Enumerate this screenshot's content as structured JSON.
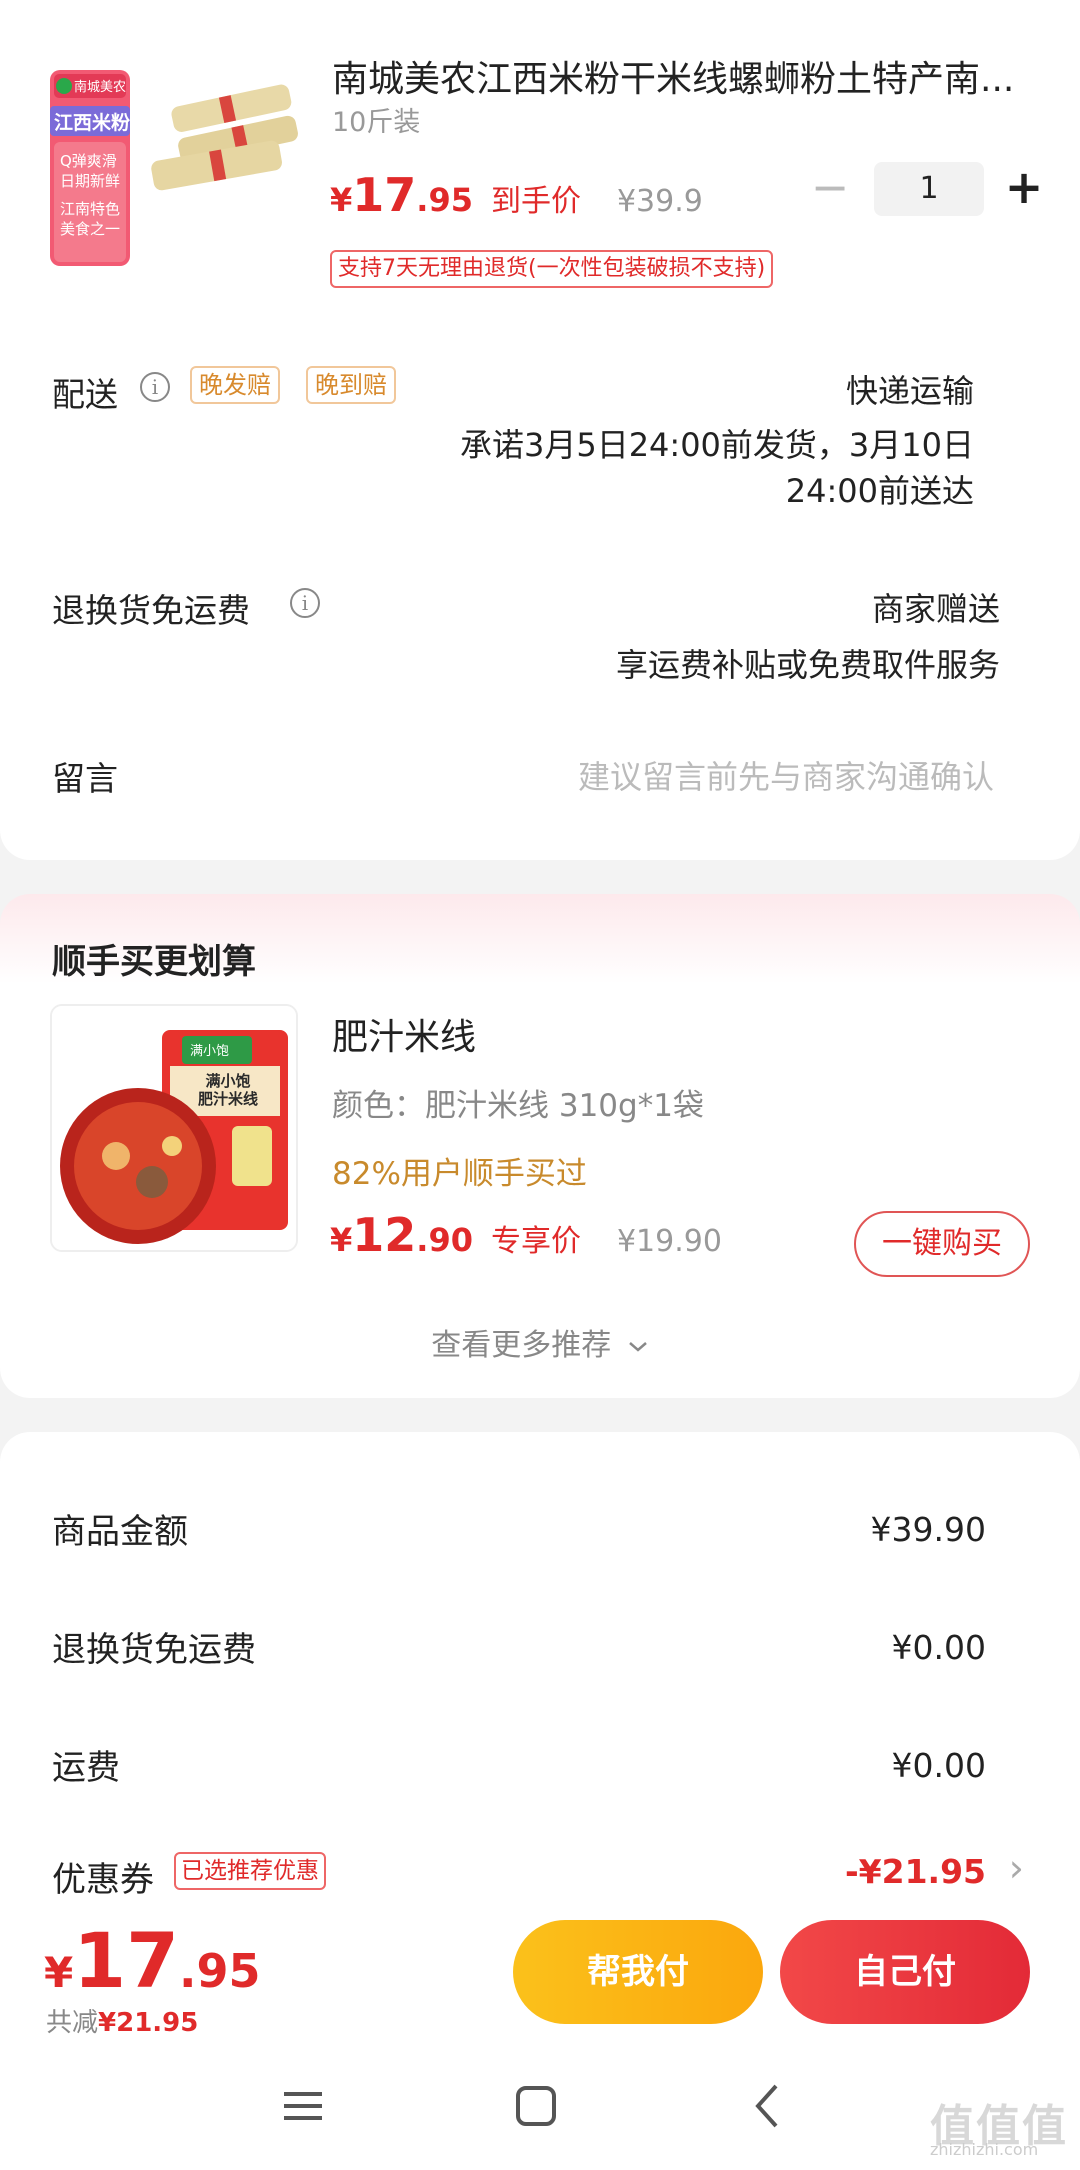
{
  "product": {
    "title": "南城美农江西米粉干米线螺蛳粉土特产南...",
    "spec": "10斤装",
    "price_yen": "¥",
    "price_int": "17",
    "price_dec": ".95",
    "price_tag": "到手价",
    "original_price": "¥39.9",
    "quantity": "1",
    "minus": "−",
    "plus": "+",
    "refund_note": "支持7天无理由退货(一次性包装破损不支持)",
    "image_texts": {
      "brand": "南城美农",
      "name": "江西米粉",
      "line1": "Q弹爽滑",
      "line2": "日期新鲜",
      "line3": "江南特色",
      "line4": "美食之一"
    }
  },
  "delivery": {
    "label": "配送",
    "info_icon": "i",
    "chips": [
      "晚发赔",
      "晚到赔"
    ],
    "method": "快递运输",
    "promise_line1": "承诺3月5日24:00前发货，3月10日",
    "promise_line2": "24:00前送达"
  },
  "return_shipping": {
    "label": "退换货免运费",
    "info_icon": "i",
    "value": "商家赠送",
    "desc": "享运费补贴或免费取件服务"
  },
  "message": {
    "label": "留言",
    "placeholder": "建议留言前先与商家沟通确认"
  },
  "recommend": {
    "section_title": "顺手买更划算",
    "name": "肥汁米线",
    "spec": "颜色：肥汁米线 310g*1袋",
    "percent_text": "82%用户顺手买过",
    "price_yen": "¥",
    "price_int": "12",
    "price_dec": ".90",
    "price_tag": "专享价",
    "original_price": "¥19.90",
    "buy_button": "一键购买",
    "more_link": "查看更多推荐",
    "image_texts": {
      "brand": "满小饱",
      "name": "满小饱\n肥汁米线"
    }
  },
  "summary": {
    "rows": [
      {
        "label": "商品金额",
        "value": "¥39.90"
      },
      {
        "label": "退换货免运费",
        "value": "¥0.00"
      },
      {
        "label": "运费",
        "value": "¥0.00"
      }
    ],
    "coupon_label": "优惠券",
    "coupon_chip": "已选推荐优惠",
    "coupon_value": "-¥21.95",
    "coupon_arrow": "›"
  },
  "footer": {
    "total_yen": "¥",
    "total_int": "17",
    "total_dec": ".95",
    "saved_prefix": "共减",
    "saved_value": "¥21.95",
    "help_pay": "帮我付",
    "self_pay": "自己付"
  },
  "watermark": {
    "text": "值值值",
    "url": "zhizhizhi.com"
  },
  "colors": {
    "accent_red": "#e02a2a",
    "gold": "#c88a2c",
    "help_btn": "#fbb614",
    "self_btn": "#e83340"
  }
}
